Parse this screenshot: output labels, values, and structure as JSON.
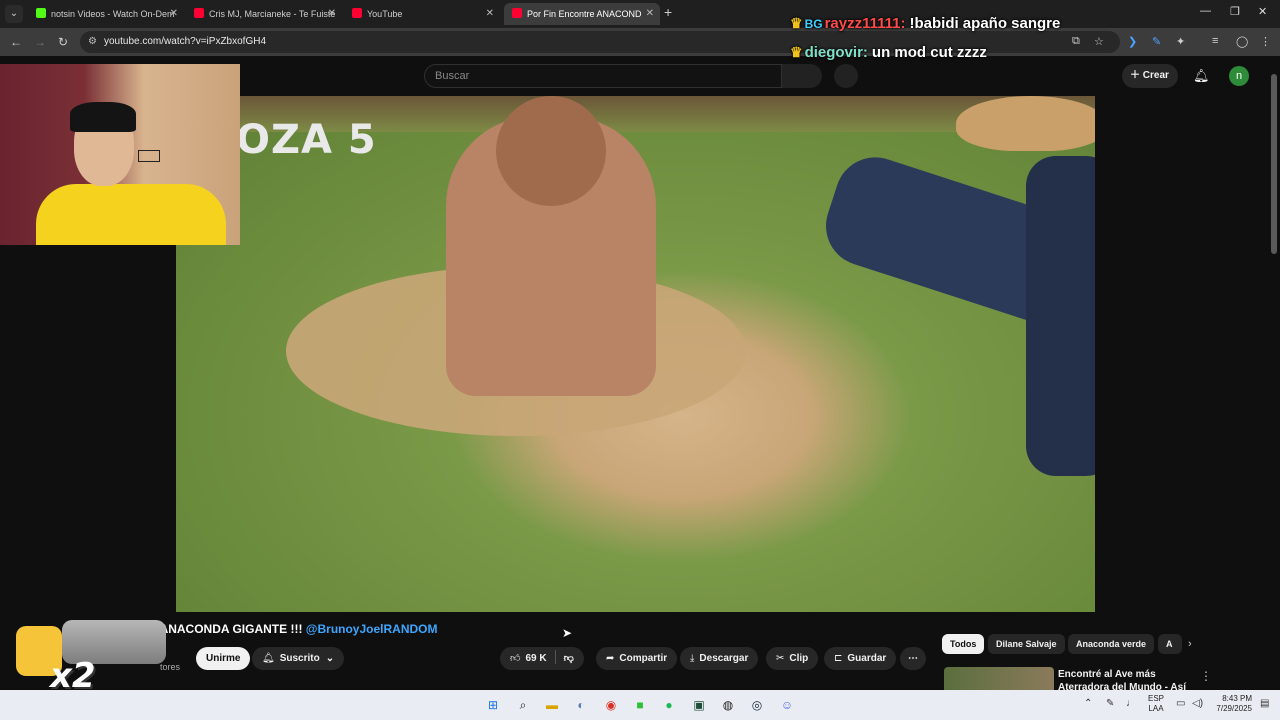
{
  "browser": {
    "tabs": [
      {
        "title": "notsin Videos - Watch On-Dem",
        "favicon_color": "#53fc18",
        "active": false
      },
      {
        "title": "Cris MJ, Marcianeke - Te Fuiste",
        "favicon_color": "#ff0033",
        "active": false
      },
      {
        "title": "YouTube",
        "favicon_color": "#ff0033",
        "active": false
      },
      {
        "title": "Por Fin Encontre ANACOND",
        "favicon_color": "#ff0033",
        "active": true
      }
    ],
    "url": "youtube.com/watch?v=iPxZbxofGH4"
  },
  "youtube": {
    "search_placeholder": "Buscar",
    "create_label": "Crear",
    "avatar_letter": "n",
    "video_overlay_text": "OZA 5",
    "title_visible": "e ANACONDA GIGANTE !!! ",
    "title_mention": "@BrunoyJoelRANDOM",
    "subs_text": "tores",
    "join_label": "Unirme",
    "subscribed_label": "Suscrito",
    "likes": "69 K",
    "share_label": "Compartir",
    "download_label": "Descargar",
    "clip_label": "Clip",
    "save_label": "Guardar",
    "chips": [
      "Todos",
      "Dilane Salvaje",
      "Anaconda verde",
      "A"
    ],
    "recommended_title": "Encontré al Ave más Aterradora del Mundo - Así es la Vida"
  },
  "chat": [
    {
      "user": "rayzz11111:",
      "message": "!babidi apaño sangre",
      "user_color": "#ff4a4a",
      "badge": "BG"
    },
    {
      "user": "diegovir:",
      "message": "un mod cut zzzz",
      "user_color": "#7fe0c8",
      "badge": ""
    }
  ],
  "emote": {
    "text": "x2"
  },
  "taskbar": {
    "lang_top": "ESP",
    "lang_bottom": "LAA",
    "time": "8:43 PM",
    "date": "7/29/2025"
  }
}
